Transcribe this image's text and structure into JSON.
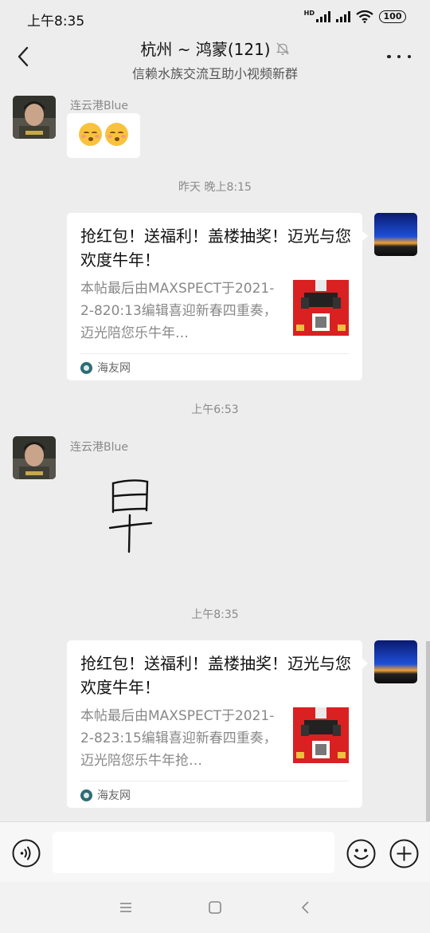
{
  "status_bar": {
    "time": "上午8:35",
    "network_label": "HD",
    "battery": "100"
  },
  "header": {
    "title": "杭州 ~ 鸿蒙(121)",
    "subtitle": "信赖水族交流互助小视频新群"
  },
  "messages": {
    "m1": {
      "sender": "连云港Blue"
    },
    "t1": "昨天 晚上8:15",
    "m2": {
      "title": "抢红包！送福利！盖楼抽奖！迈光与您欢度牛年！",
      "desc": "本帖最后由MAXSPECT于2021-2-820:13编辑喜迎新春四重奏，迈光陪您乐牛年…",
      "source": "海友网"
    },
    "t2": "上午6:53",
    "m3": {
      "sender": "连云港Blue",
      "handwriting": "早"
    },
    "t3": "上午8:35",
    "m4": {
      "title": "抢红包！送福利！盖楼抽奖！迈光与您欢度牛年！",
      "desc": "本帖最后由MAXSPECT于2021-2-823:15编辑喜迎新春四重奏，迈光陪您乐牛年抢…",
      "source": "海友网"
    }
  },
  "input": {
    "value": "",
    "placeholder": ""
  },
  "colors": {
    "background": "#ededed",
    "bubble": "#ffffff",
    "muted_text": "#8a8a8a"
  }
}
